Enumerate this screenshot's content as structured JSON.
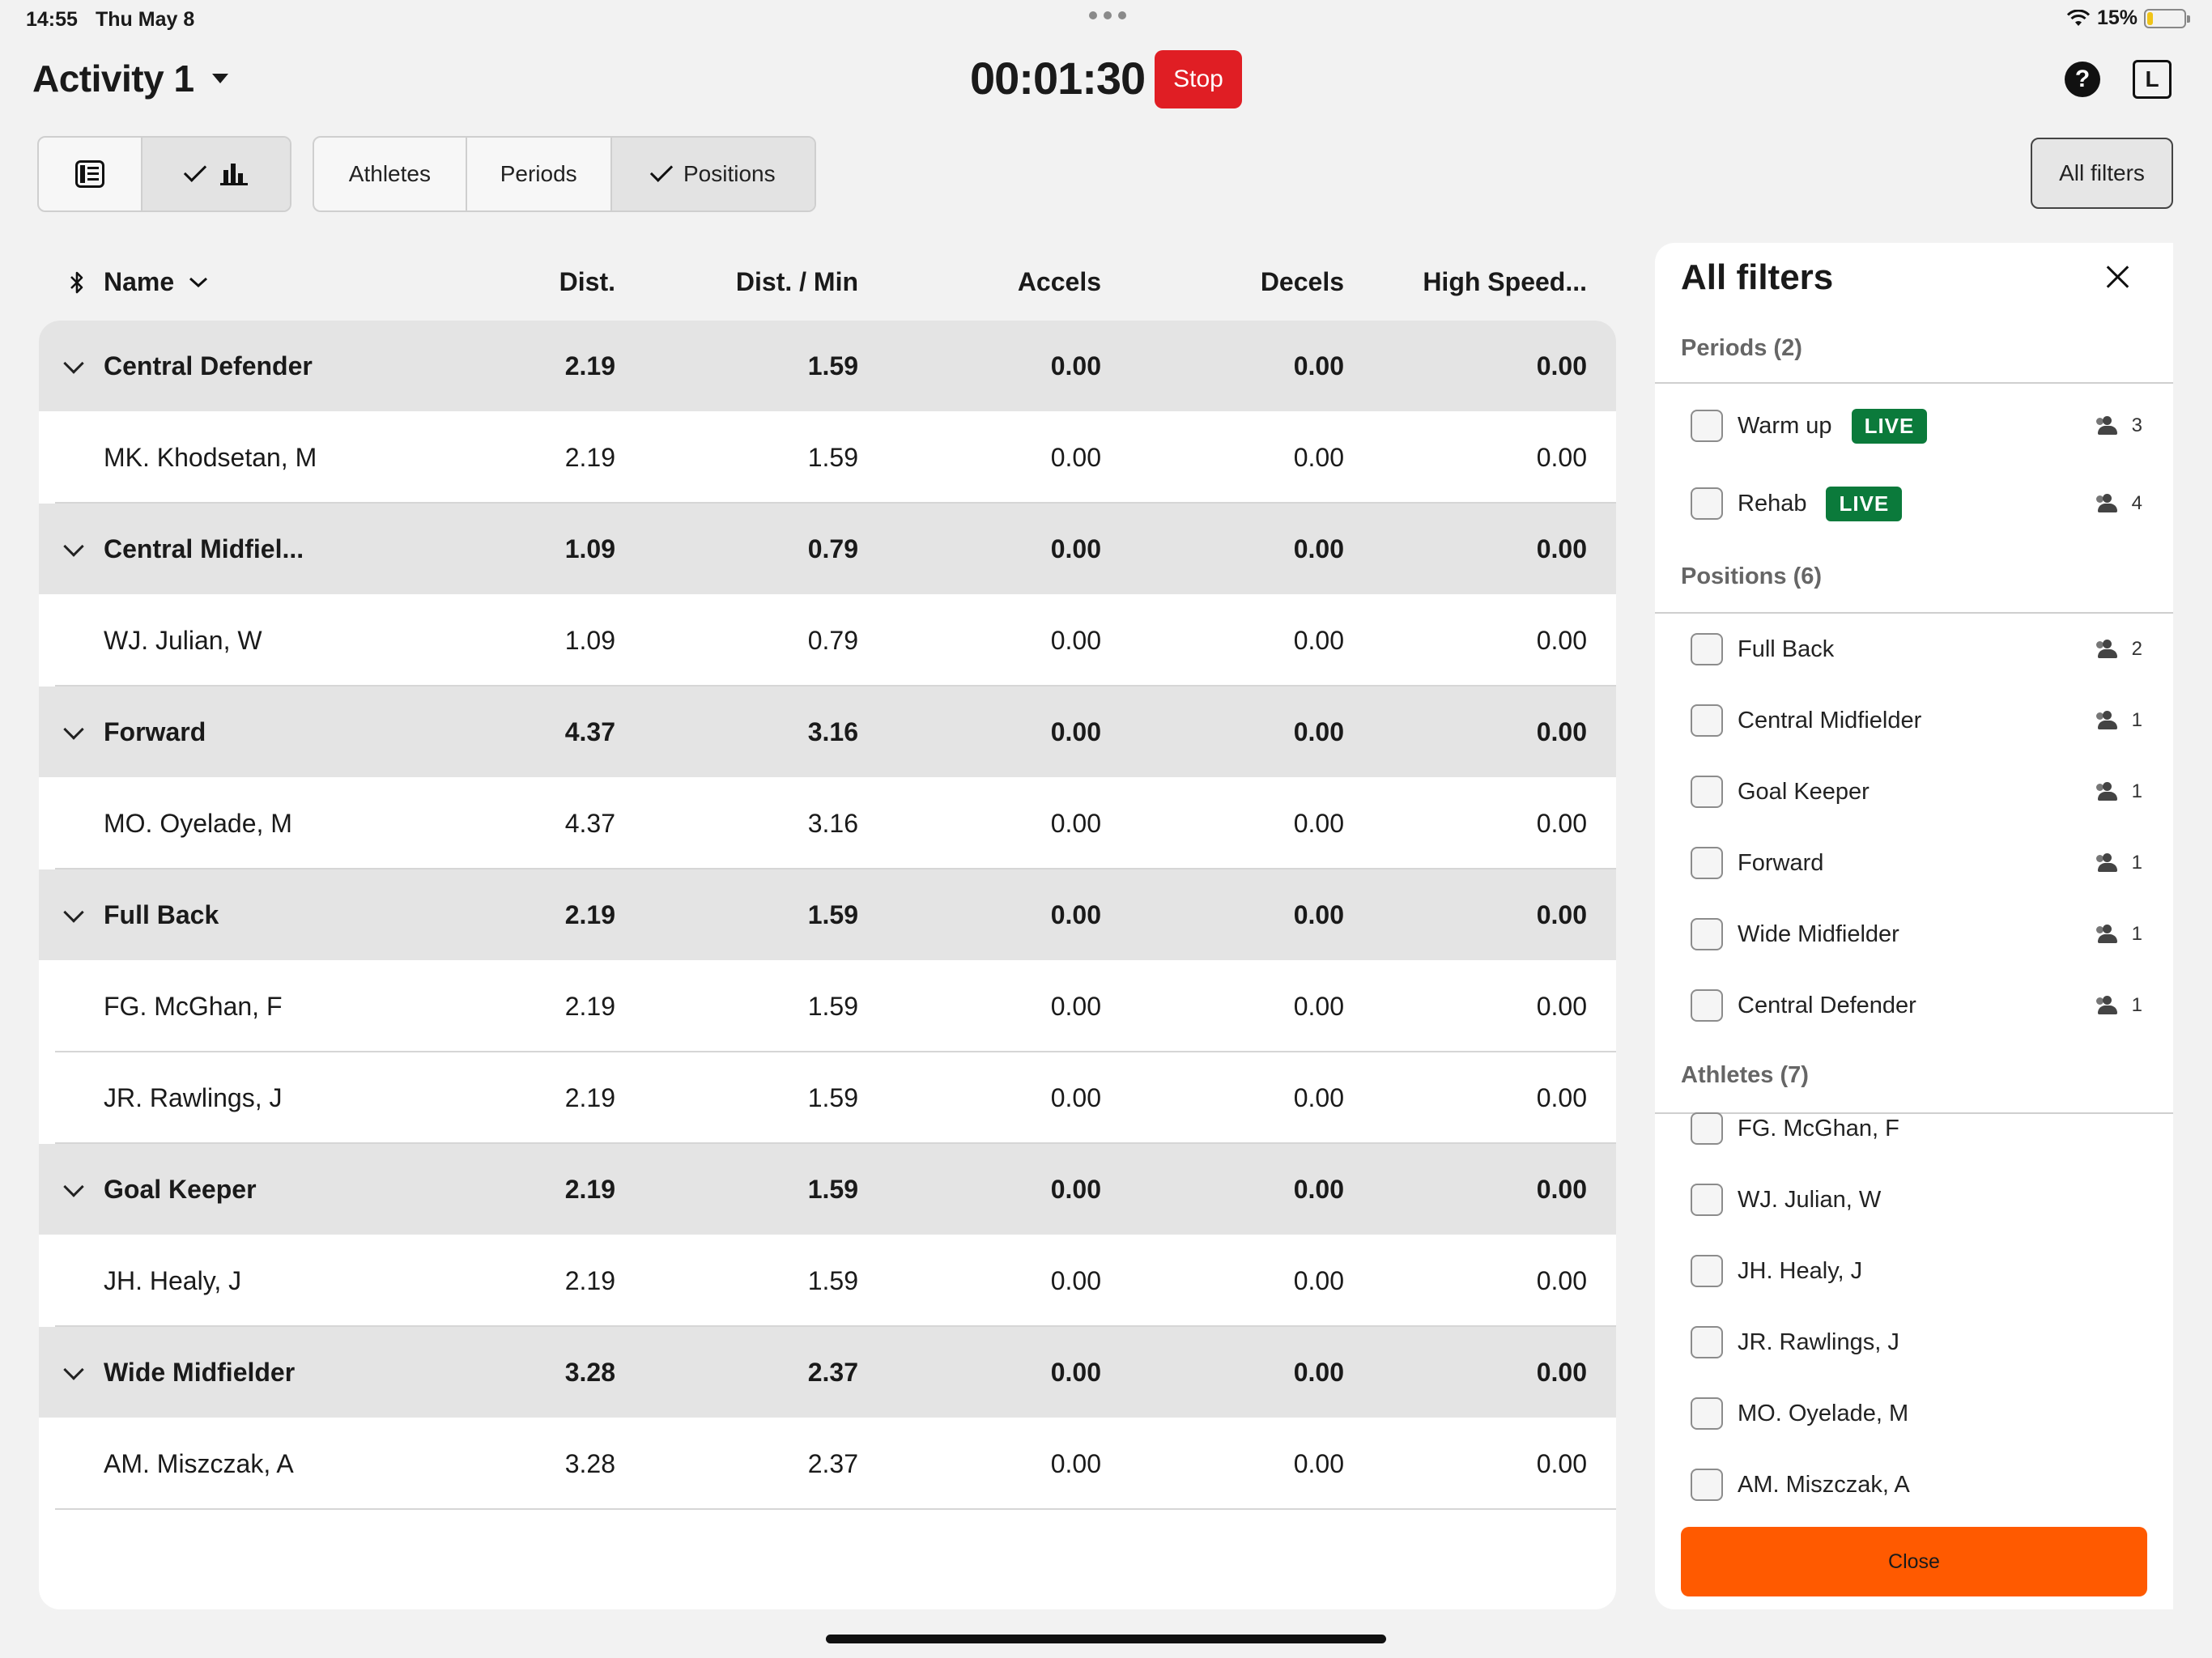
{
  "status": {
    "time": "14:55",
    "date": "Thu May 8",
    "battery": "15%",
    "battery_level": 0.15
  },
  "header": {
    "title": "Activity 1",
    "timer": "00:01:30",
    "stop_label": "Stop",
    "help": "?",
    "layout_badge": "L"
  },
  "toolbar": {
    "athletes": "Athletes",
    "periods": "Periods",
    "positions": "Positions",
    "all_filters": "All filters"
  },
  "table": {
    "columns": {
      "name": "Name",
      "dist": "Dist.",
      "dpm": "Dist. / Min",
      "accels": "Accels",
      "decels": "Decels",
      "hs": "High Speed..."
    },
    "rows": [
      {
        "type": "group",
        "name": "Central Defender",
        "dist": "2.19",
        "dpm": "1.59",
        "accels": "0.00",
        "decels": "0.00",
        "hs": "0.00"
      },
      {
        "type": "ath",
        "name": "MK. Khodsetan, M",
        "dist": "2.19",
        "dpm": "1.59",
        "accels": "0.00",
        "decels": "0.00",
        "hs": "0.00"
      },
      {
        "type": "group",
        "name": "Central Midfiel...",
        "dist": "1.09",
        "dpm": "0.79",
        "accels": "0.00",
        "decels": "0.00",
        "hs": "0.00"
      },
      {
        "type": "ath",
        "name": "WJ. Julian, W",
        "dist": "1.09",
        "dpm": "0.79",
        "accels": "0.00",
        "decels": "0.00",
        "hs": "0.00"
      },
      {
        "type": "group",
        "name": "Forward",
        "dist": "4.37",
        "dpm": "3.16",
        "accels": "0.00",
        "decels": "0.00",
        "hs": "0.00"
      },
      {
        "type": "ath",
        "name": "MO. Oyelade, M",
        "dist": "4.37",
        "dpm": "3.16",
        "accels": "0.00",
        "decels": "0.00",
        "hs": "0.00"
      },
      {
        "type": "group",
        "name": "Full Back",
        "dist": "2.19",
        "dpm": "1.59",
        "accels": "0.00",
        "decels": "0.00",
        "hs": "0.00"
      },
      {
        "type": "ath",
        "name": "FG. McGhan, F",
        "dist": "2.19",
        "dpm": "1.59",
        "accels": "0.00",
        "decels": "0.00",
        "hs": "0.00"
      },
      {
        "type": "ath",
        "name": "JR. Rawlings, J",
        "dist": "2.19",
        "dpm": "1.59",
        "accels": "0.00",
        "decels": "0.00",
        "hs": "0.00"
      },
      {
        "type": "group",
        "name": "Goal Keeper",
        "dist": "2.19",
        "dpm": "1.59",
        "accels": "0.00",
        "decels": "0.00",
        "hs": "0.00"
      },
      {
        "type": "ath",
        "name": "JH. Healy, J",
        "dist": "2.19",
        "dpm": "1.59",
        "accels": "0.00",
        "decels": "0.00",
        "hs": "0.00"
      },
      {
        "type": "group",
        "name": "Wide Midfielder",
        "dist": "3.28",
        "dpm": "2.37",
        "accels": "0.00",
        "decels": "0.00",
        "hs": "0.00"
      },
      {
        "type": "ath",
        "name": "AM. Miszczak, A",
        "dist": "3.28",
        "dpm": "2.37",
        "accels": "0.00",
        "decels": "0.00",
        "hs": "0.00"
      }
    ]
  },
  "filters": {
    "title": "All filters",
    "periods_title": "Periods (2)",
    "periods": [
      {
        "label": "Warm up",
        "badge": "LIVE",
        "count": "3"
      },
      {
        "label": "Rehab",
        "badge": "LIVE",
        "count": "4"
      }
    ],
    "positions_title": "Positions (6)",
    "positions": [
      {
        "label": "Full Back",
        "count": "2"
      },
      {
        "label": "Central Midfielder",
        "count": "1"
      },
      {
        "label": "Goal Keeper",
        "count": "1"
      },
      {
        "label": "Forward",
        "count": "1"
      },
      {
        "label": "Wide Midfielder",
        "count": "1"
      },
      {
        "label": "Central Defender",
        "count": "1"
      }
    ],
    "athletes_title": "Athletes (7)",
    "athletes": [
      {
        "label": "FG. McGhan, F"
      },
      {
        "label": "WJ. Julian, W"
      },
      {
        "label": "JH. Healy, J"
      },
      {
        "label": "JR. Rawlings, J"
      },
      {
        "label": "MO. Oyelade, M"
      },
      {
        "label": "AM. Miszczak, A"
      }
    ],
    "close_label": "Close"
  }
}
